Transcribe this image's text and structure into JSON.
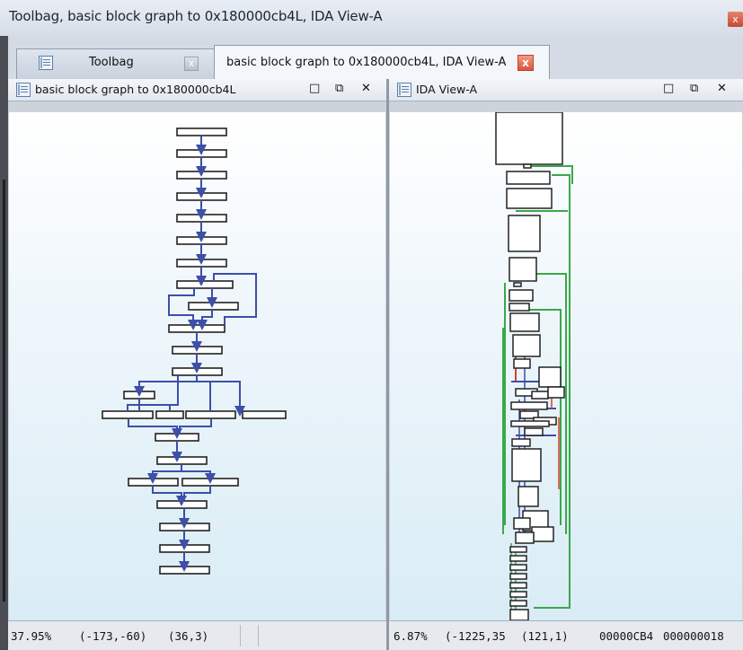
{
  "window": {
    "title": "Toolbag, basic block graph to 0x180000cb4L, IDA View-A",
    "close_glyph": "x"
  },
  "tabs": [
    {
      "label": "Toolbag",
      "icon": "document-list-icon",
      "close_glyph": "x"
    },
    {
      "label": "basic block graph to 0x180000cb4L, IDA View-A",
      "close_glyph": "x"
    }
  ],
  "left_pane": {
    "title": "basic block graph to 0x180000cb4L",
    "icon": "document-list-icon",
    "controls": {
      "maximize": "□",
      "restore": "⧉",
      "close": "✕"
    },
    "status": {
      "zoom": "37.95%",
      "mouse": "(-173,-60)",
      "cursor": "(36,3)"
    }
  },
  "right_pane": {
    "title": "IDA View-A",
    "icon": "document-list-icon",
    "controls": {
      "maximize": "□",
      "restore": "⧉",
      "close": "✕"
    },
    "status": {
      "zoom": "6.87%",
      "mouse": "(-1225,35",
      "cursor": "(121,1)",
      "address": "00000CB4",
      "address2": "000000018"
    }
  },
  "colors": {
    "graph_edge": "#3d4fa8",
    "green_edge": "#3aa84a",
    "red_edge": "#d9402b",
    "canvas_top": "#ffffff",
    "canvas_bottom": "#d9ecf5"
  }
}
